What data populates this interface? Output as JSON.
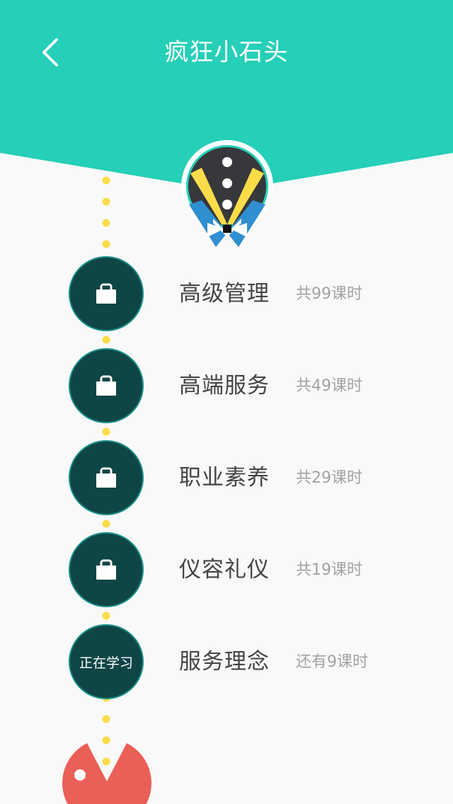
{
  "header": {
    "title": "疯狂小石头",
    "back_icon": "chevron-left-icon",
    "background_color": "#26cfb8"
  },
  "avatar": {
    "icon": "tuxedo-avatar-icon"
  },
  "path": {
    "dot_color": "#fddc4a"
  },
  "courses": [
    {
      "name": "高级管理",
      "hours": "共99课时",
      "status": "locked",
      "icon": "lock-icon"
    },
    {
      "name": "高端服务",
      "hours": "共49课时",
      "status": "locked",
      "icon": "lock-icon"
    },
    {
      "name": "职业素养",
      "hours": "共29课时",
      "status": "locked",
      "icon": "lock-icon"
    },
    {
      "name": "仪容礼仪",
      "hours": "共19课时",
      "status": "locked",
      "icon": "lock-icon"
    },
    {
      "name": "服务理念",
      "hours": "还有9课时",
      "status": "current",
      "circle_label": "正在学习"
    }
  ],
  "progress_marker": {
    "icon": "pacman-icon",
    "color": "#ea5f57"
  }
}
